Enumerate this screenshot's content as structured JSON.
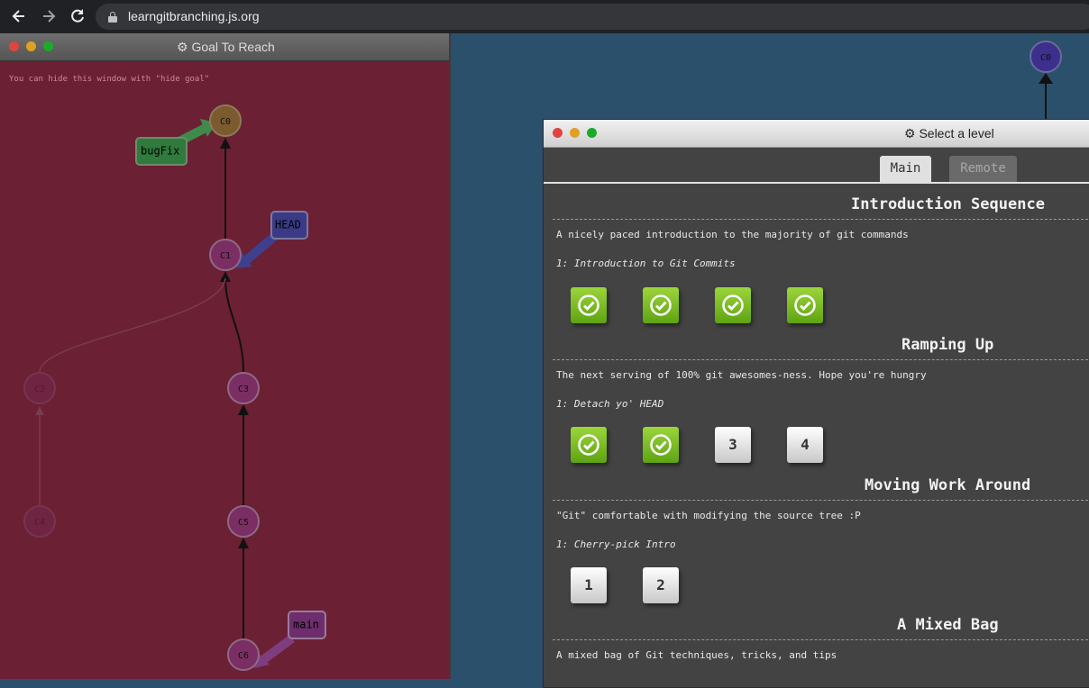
{
  "browser": {
    "back_icon": "back-arrow-icon",
    "forward_icon": "forward-arrow-icon",
    "reload_icon": "reload-icon",
    "url": "learngitbranching.js.org"
  },
  "goal_window": {
    "title": "⚙ Goal To Reach",
    "hint": "You can hide this window with \"hide goal\"",
    "commits": [
      "C0",
      "C1",
      "C2",
      "C3",
      "C4",
      "C5",
      "C6"
    ],
    "branches": {
      "bugfix": "bugFix",
      "head": "HEAD",
      "main": "main"
    }
  },
  "remote_commit": "C0",
  "level_window": {
    "title": "⚙ Select a level",
    "tabs": {
      "main": "Main",
      "remote": "Remote"
    },
    "sequences": [
      {
        "title": "Introduction Sequence",
        "desc": "A nicely paced introduction to the majority of git commands",
        "level_name": "1: Introduction to Git Commits",
        "levels": [
          "✓",
          "✓",
          "✓",
          "✓"
        ]
      },
      {
        "title": "Ramping Up",
        "desc": "The next serving of 100% git awesomes-ness. Hope you're hungry",
        "level_name": "1: Detach yo' HEAD",
        "levels": [
          "✓",
          "✓",
          "3",
          "4"
        ]
      },
      {
        "title": "Moving Work Around",
        "desc": "\"Git\" comfortable with modifying the source tree :P",
        "level_name": "1: Cherry-pick Intro",
        "levels": [
          "1",
          "2"
        ]
      },
      {
        "title": "A Mixed Bag",
        "desc": "A mixed bag of Git techniques, tricks, and tips"
      }
    ]
  },
  "colors": {
    "goal_bg": "#6b2034",
    "remote_bg": "#2b506c",
    "solved_green": "#7cc226",
    "commit_purple": "#7b2e63",
    "commit_c0": "#7b5a2e"
  }
}
